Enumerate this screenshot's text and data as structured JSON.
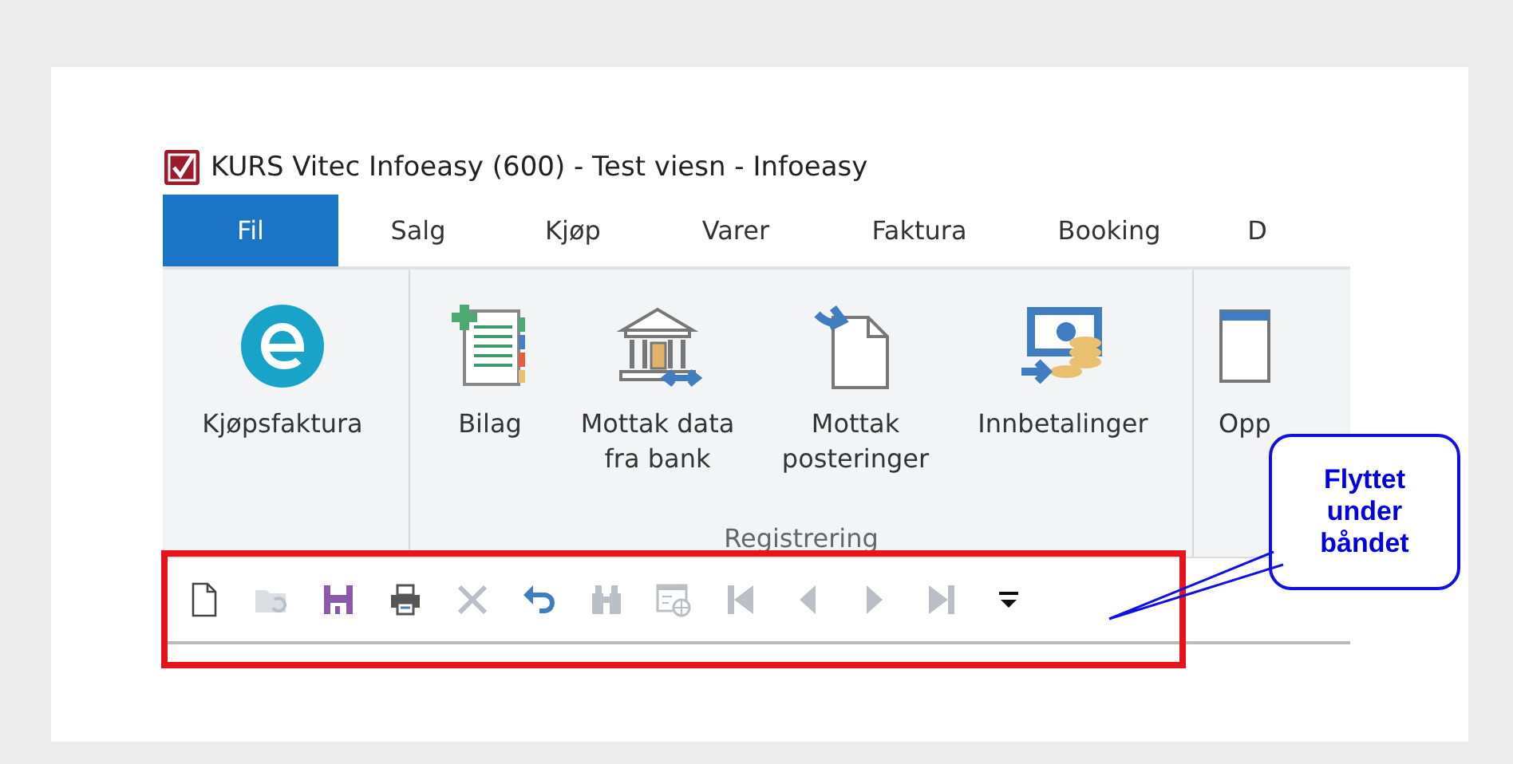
{
  "window": {
    "title": "KURS Vitec Infoeasy (600) - Test viesn - Infoeasy"
  },
  "tabs": [
    {
      "label": "Fil",
      "selected": true
    },
    {
      "label": "Salg",
      "selected": false
    },
    {
      "label": "Kjøp",
      "selected": false
    },
    {
      "label": "Varer",
      "selected": false
    },
    {
      "label": "Faktura",
      "selected": false
    },
    {
      "label": "Booking",
      "selected": false
    },
    {
      "label": "D",
      "selected": false
    }
  ],
  "ribbon": {
    "groups": [
      {
        "buttons": [
          {
            "label": "Kjøpsfaktura",
            "kind": "e-circle"
          }
        ]
      },
      {
        "label": "Registrering",
        "buttons": [
          {
            "label": "Bilag",
            "kind": "ledger"
          },
          {
            "label": "Mottak data fra bank",
            "kind": "bank"
          },
          {
            "label": "Mottak posteringer",
            "kind": "document"
          },
          {
            "label": "Innbetalinger",
            "kind": "money"
          }
        ]
      },
      {
        "buttons": [
          {
            "label": "Opp",
            "kind": "report"
          }
        ]
      }
    ]
  },
  "quick_access_toolbar": {
    "buttons": [
      {
        "kind": "new",
        "disabled": false
      },
      {
        "kind": "open",
        "disabled": true
      },
      {
        "kind": "save",
        "disabled": false
      },
      {
        "kind": "print",
        "disabled": false
      },
      {
        "kind": "delete",
        "disabled": true
      },
      {
        "kind": "undo",
        "disabled": false
      },
      {
        "kind": "find",
        "disabled": true
      },
      {
        "kind": "browse",
        "disabled": true
      },
      {
        "kind": "first",
        "disabled": true
      },
      {
        "kind": "previous",
        "disabled": true
      },
      {
        "kind": "next",
        "disabled": true
      },
      {
        "kind": "last",
        "disabled": true
      },
      {
        "kind": "more",
        "disabled": false
      }
    ]
  },
  "callout": {
    "text": "Flyttet under båndet"
  }
}
